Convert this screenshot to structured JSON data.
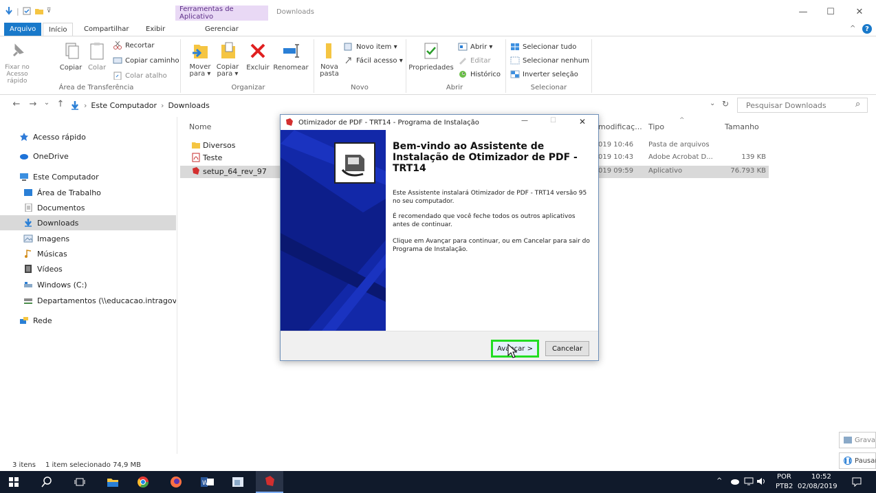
{
  "window": {
    "tool_tab_header": "Ferramentas de Aplicativo",
    "title": "Downloads",
    "controls": {
      "minimize": "—",
      "maximize": "☐",
      "close": "✕"
    }
  },
  "tabs": {
    "file": "Arquivo",
    "home": "Início",
    "share": "Compartilhar",
    "view": "Exibir",
    "manage": "Gerenciar"
  },
  "ribbon": {
    "clipboard": {
      "pin": "Fixar no\nAcesso rápido",
      "copy": "Copiar",
      "paste": "Colar",
      "cut": "Recortar",
      "copy_path": "Copiar caminho",
      "paste_shortcut": "Colar atalho",
      "label": "Área de Transferência"
    },
    "organize": {
      "move": "Mover\npara ▾",
      "copy_to": "Copiar\npara ▾",
      "delete": "Excluir",
      "rename": "Renomear",
      "label": "Organizar"
    },
    "new": {
      "folder": "Nova\npasta",
      "item": "Novo item ▾",
      "easy": "Fácil acesso ▾",
      "label": "Novo"
    },
    "open": {
      "properties": "Propriedades",
      "open": "Abrir ▾",
      "edit": "Editar",
      "history": "Histórico",
      "label": "Abrir"
    },
    "select": {
      "all": "Selecionar tudo",
      "none": "Selecionar nenhum",
      "invert": "Inverter seleção",
      "label": "Selecionar"
    }
  },
  "address": {
    "back": "←",
    "forward": "→",
    "recent": "⌄",
    "up": "↑",
    "crumb_sep1": "›",
    "computer": "Este Computador",
    "crumb_sep2": "›",
    "folder": "Downloads",
    "dropdown": "⌄",
    "refresh": "↻",
    "search_placeholder": "Pesquisar Downloads",
    "search_icon": "⌕"
  },
  "nav": {
    "items": [
      {
        "label": "Acesso rápido",
        "color": "#2f7bd8"
      },
      {
        "label": "OneDrive",
        "color": "#1e73d8"
      },
      {
        "label": "Este Computador",
        "color": "#3b8fe0"
      },
      {
        "label": "Área de Trabalho",
        "color": "#2a7fd6"
      },
      {
        "label": "Documentos",
        "color": "#8c8c8c"
      },
      {
        "label": "Downloads",
        "color": "#2a7fd6"
      },
      {
        "label": "Imagens",
        "color": "#6f8fae"
      },
      {
        "label": "Músicas",
        "color": "#d28c1a"
      },
      {
        "label": "Vídeos",
        "color": "#444"
      },
      {
        "label": "Windows (C:)",
        "color": "#6a8aa8"
      },
      {
        "label": "Departamentos (\\\\educacao.intragov\\vot",
        "color": "#4a8c4a"
      },
      {
        "label": "Rede",
        "color": "#2a7fd6"
      }
    ]
  },
  "files": {
    "headers": {
      "name": "Nome",
      "modified": "modificaç...",
      "type": "Tipo",
      "size": "Tamanho",
      "sort_arrow": "^"
    },
    "rows": [
      {
        "name": "Diversos",
        "modified": "019 10:46",
        "type": "Pasta de arquivos",
        "size": ""
      },
      {
        "name": "Teste",
        "modified": "019 10:43",
        "type": "Adobe Acrobat D...",
        "size": "139 KB"
      },
      {
        "name": "setup_64_rev_97",
        "modified": "019 09:59",
        "type": "Aplicativo",
        "size": "76.793 KB"
      }
    ]
  },
  "status": {
    "count": "3 itens",
    "selection": "1 item selecionado  74,9 MB"
  },
  "dialog": {
    "title": "Otimizador de PDF - TRT14 - Programa de Instalação",
    "controls": {
      "minimize": "—",
      "maximize": "☐",
      "close": "✕"
    },
    "heading": "Bem-vindo ao Assistente de Instalação de Otimizador de PDF - TRT14",
    "p1": "Este Assistente instalará Otimizador de PDF - TRT14 versão 95 no seu computador.",
    "p2": "É recomendado que você feche todos os outros aplicativos antes de continuar.",
    "p3": "Clique em Avançar para continuar, ou em Cancelar para sair do Programa de Instalação.",
    "next": "Avançar >",
    "cancel": "Cancelar"
  },
  "side_popups": {
    "record": "Grava",
    "pause": "Pausar"
  },
  "taskbar": {
    "tray_arrow": "^",
    "lang": "POR",
    "layout": "PTB2",
    "time": "10:52",
    "date": "02/08/2019"
  },
  "colors": {
    "accent": "#1979ca",
    "highlight": "#22dd22",
    "taskbar": "#101a2b",
    "wizard_side": "#1228a8"
  }
}
